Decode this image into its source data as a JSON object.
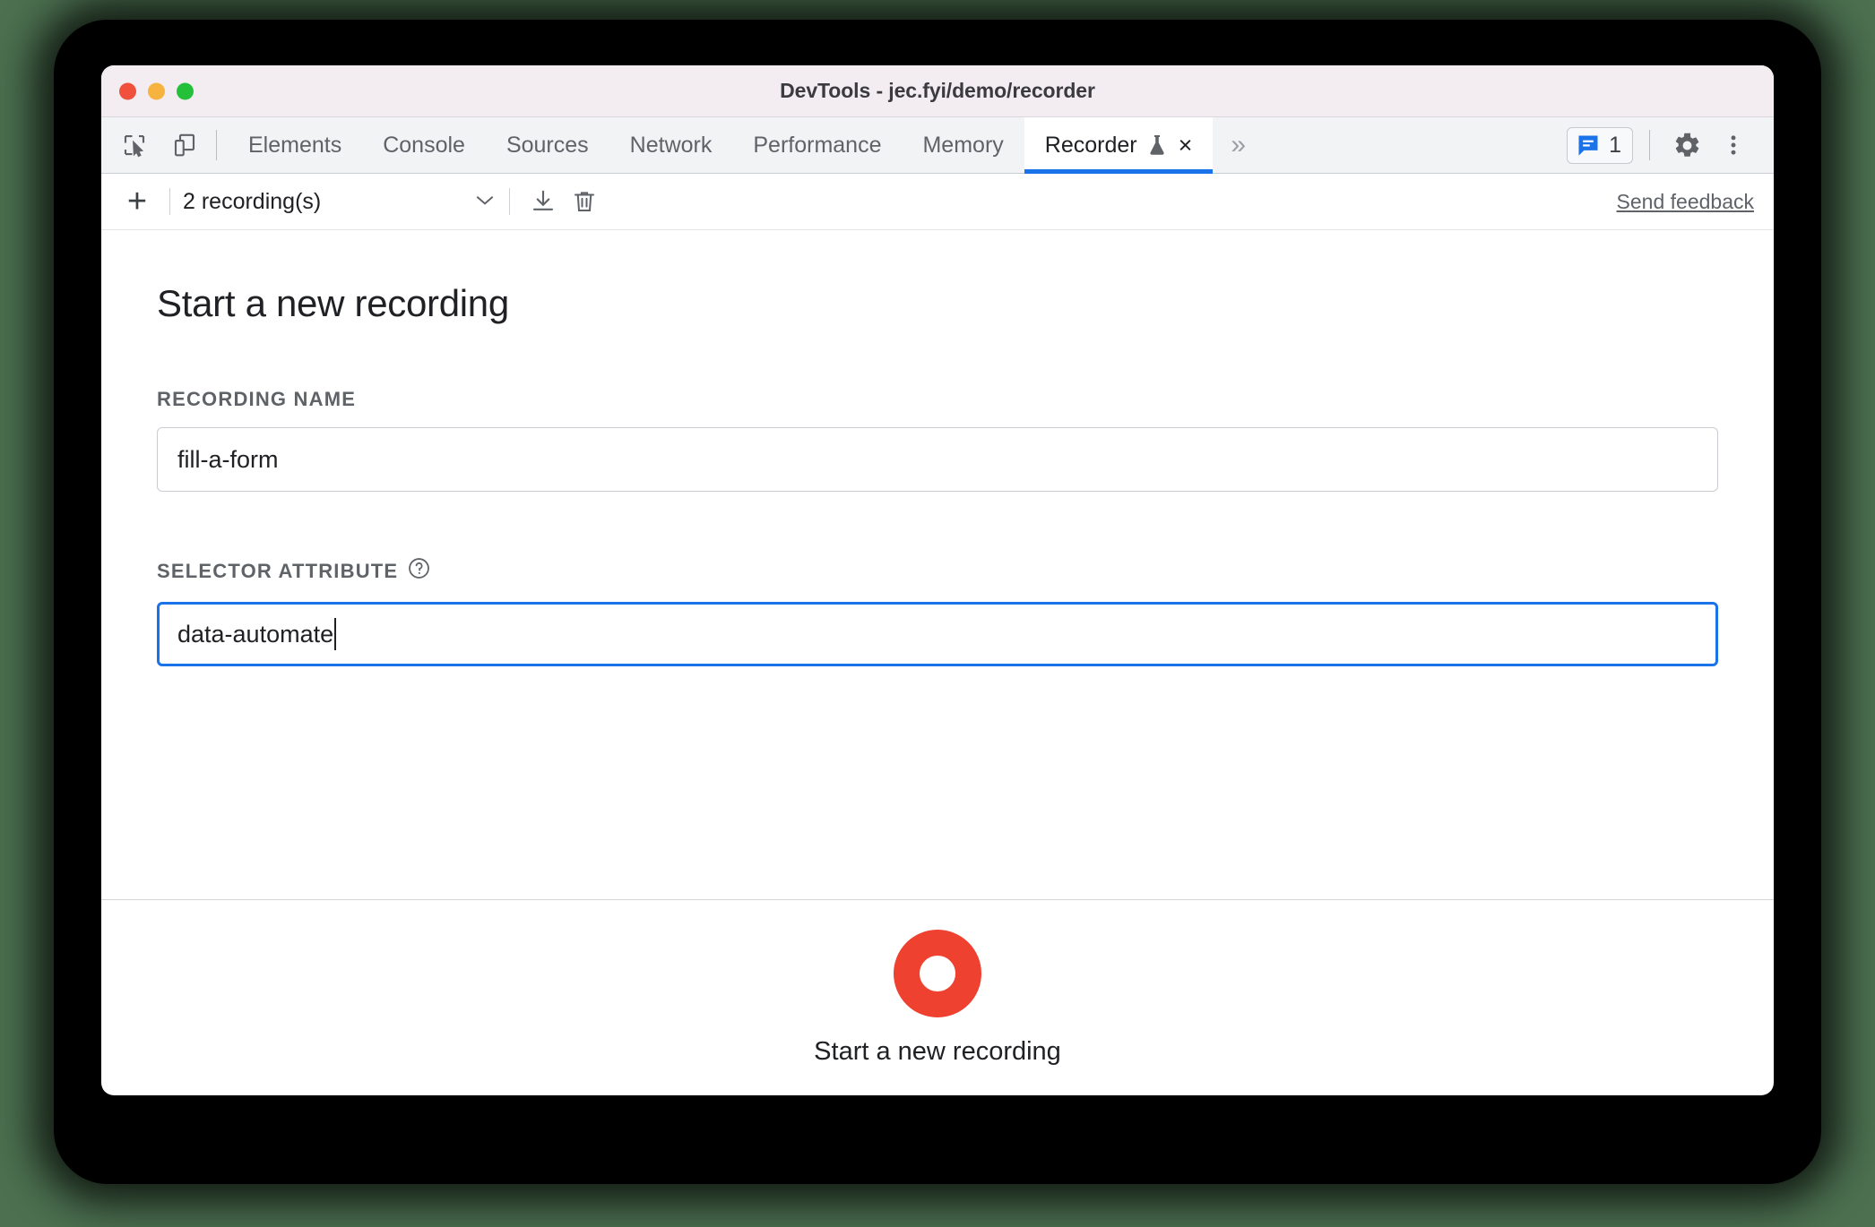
{
  "window": {
    "title": "DevTools - jec.fyi/demo/recorder",
    "traffic_lights": [
      "close",
      "minimize",
      "zoom"
    ],
    "colors": {
      "accent_blue": "#1a73e8",
      "record_red": "#ef4130",
      "titlebar_bg": "#f3edf2",
      "tabstrip_bg": "#f1f3f4",
      "desktop_bg": "#4c7050"
    }
  },
  "tabstrip": {
    "left_icons": [
      {
        "name": "inspect-element-icon",
        "label": "Inspect element"
      },
      {
        "name": "device-toolbar-icon",
        "label": "Toggle device toolbar"
      }
    ],
    "tabs": [
      {
        "label": "Elements",
        "active": false
      },
      {
        "label": "Console",
        "active": false
      },
      {
        "label": "Sources",
        "active": false
      },
      {
        "label": "Network",
        "active": false
      },
      {
        "label": "Performance",
        "active": false
      },
      {
        "label": "Memory",
        "active": false
      },
      {
        "label": "Recorder",
        "active": true,
        "experimental": true,
        "closeable": true
      }
    ],
    "overflow_label": "»",
    "close_label": "×",
    "message_count": "1",
    "right_icons": [
      {
        "name": "console-message-icon",
        "label": "Open Console"
      },
      {
        "name": "gear-icon",
        "label": "Settings"
      },
      {
        "name": "more-options-icon",
        "label": "Customize and control DevTools"
      }
    ]
  },
  "recorder_toolbar": {
    "add_label": "+",
    "recordings_select": "2 recording(s)",
    "caret": "⌄",
    "import_label": "Import recording",
    "delete_label": "Delete recording",
    "send_feedback": "Send feedback"
  },
  "main": {
    "title": "Start a new recording",
    "fields": [
      {
        "label": "RECORDING NAME",
        "value": "fill-a-form",
        "placeholder": "Recording name",
        "focused": false,
        "help": false
      },
      {
        "label": "SELECTOR ATTRIBUTE",
        "value": "data-automate",
        "placeholder": "Selector attribute",
        "focused": true,
        "help": true,
        "help_glyph": "?"
      }
    ]
  },
  "footer": {
    "record_button_label": "Start a new recording",
    "record_icon": "record-circle-icon"
  }
}
